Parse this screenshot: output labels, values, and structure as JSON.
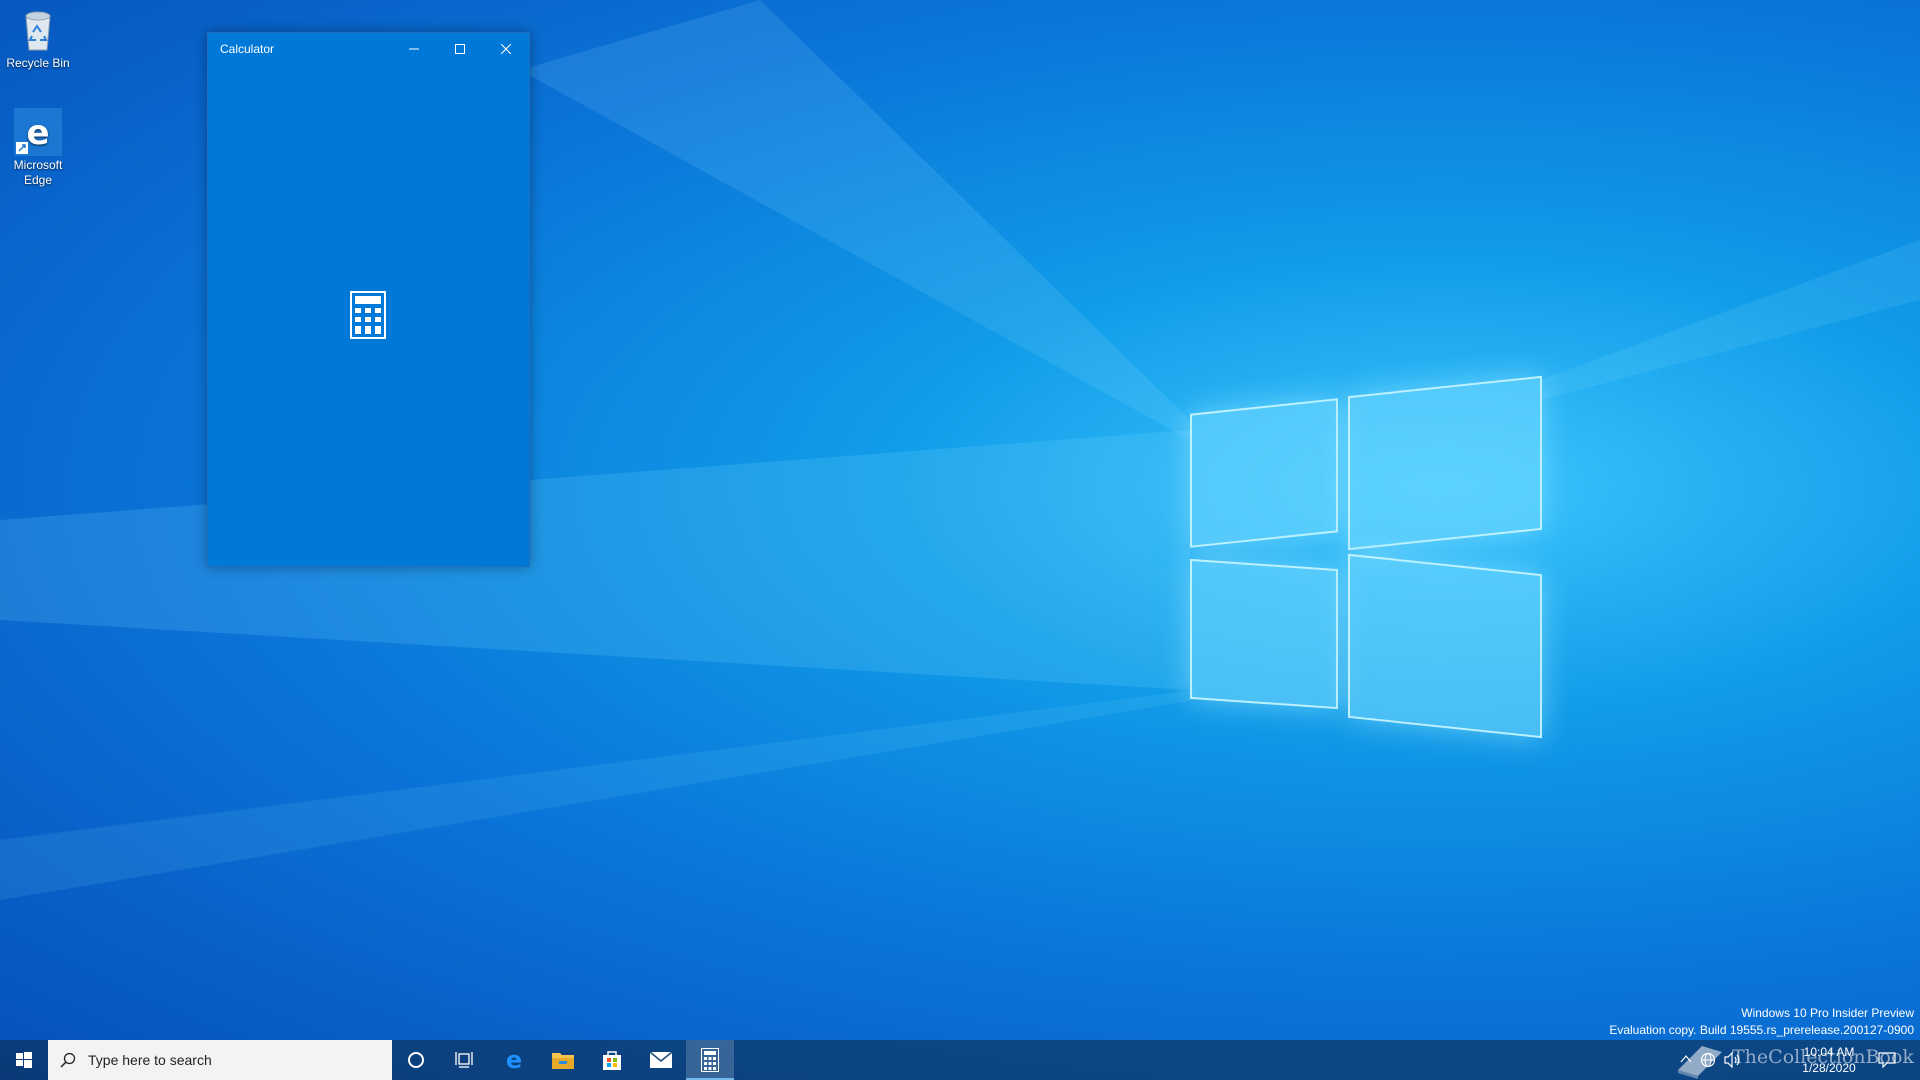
{
  "desktop": {
    "icons": [
      {
        "label": "Recycle Bin",
        "icon": "recycle-bin-icon"
      },
      {
        "label": "Microsoft Edge",
        "icon": "edge-icon"
      }
    ]
  },
  "calculator": {
    "title": "Calculator",
    "controls": {
      "minimize": "minimize-icon",
      "maximize": "maximize-icon",
      "close": "close-icon"
    },
    "splash_icon": "calculator-icon",
    "background": "#0078d7"
  },
  "taskbar": {
    "search_placeholder": "Type here to search",
    "apps": [
      "start-icon",
      "cortana-icon",
      "task-view-icon",
      "edge-icon",
      "file-explorer-icon",
      "store-icon",
      "mail-icon",
      "calculator-icon"
    ]
  },
  "watermark": {
    "line1": "Windows 10 Pro Insider Preview",
    "line2": "Evaluation copy. Build 19555.rs_prerelease.200127-0900"
  },
  "clock": {
    "time": "10:04 AM",
    "date": "1/28/2020"
  },
  "overlay": {
    "text": "TheCollectionBook"
  },
  "colors": {
    "accent": "#0078d7",
    "desktop": "#0a74d8"
  }
}
